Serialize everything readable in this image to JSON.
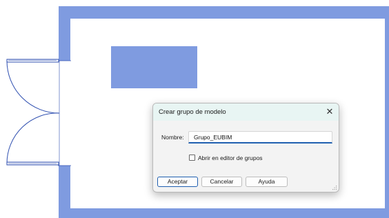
{
  "colors": {
    "wall": "#7f9be0",
    "floor": "#ffffff",
    "selected_element": "#7f9be0",
    "door_line": "#2f4fb0",
    "accent": "#1f5fb0",
    "dialog_header": "#e8f5f3"
  },
  "dialog": {
    "title": "Crear grupo de modelo",
    "close_icon": "close-icon",
    "name_label": "Nombre:",
    "name_value": "Grupo_EUBIM",
    "checkbox_label": "Abrir en editor de grupos",
    "checkbox_checked": false,
    "buttons": {
      "ok": "Aceptar",
      "cancel": "Cancelar",
      "help": "Ayuda"
    }
  }
}
